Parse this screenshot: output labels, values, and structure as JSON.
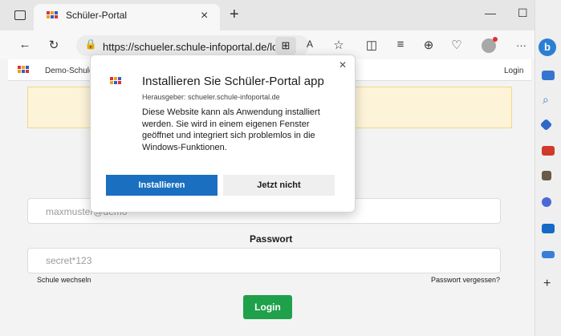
{
  "tab": {
    "title": "Schüler-Portal",
    "close": "×",
    "new": "+"
  },
  "window": {
    "minimize": "—",
    "maximize": "☐",
    "close": "✕"
  },
  "address": {
    "url": "https://schueler.schule-infoportal.de/lo...",
    "more": "···"
  },
  "page": {
    "nav_brand": "Demo-Schule",
    "nav_login": "Login",
    "user_placeholder": "maxmuster@demo",
    "password_label": "Passwort",
    "password_placeholder": "secret*123",
    "switch_school": "Schule wechseln",
    "forgot_password": "Passwort vergessen?",
    "login_button": "Login"
  },
  "dialog": {
    "title": "Installieren Sie Schüler-Portal app",
    "publisher": "Herausgeber: schueler.schule-infoportal.de",
    "body": "Diese Website kann als Anwendung installiert werden. Sie wird in einem eigenen Fenster geöffnet und integriert sich problemlos in die Windows-Funktionen.",
    "install": "Installieren",
    "not_now": "Jetzt nicht",
    "close": "✕"
  },
  "colors": {
    "accent": "#1a6fc0",
    "login_green": "#1fa04a",
    "alert_bg": "#fdf3d8"
  }
}
